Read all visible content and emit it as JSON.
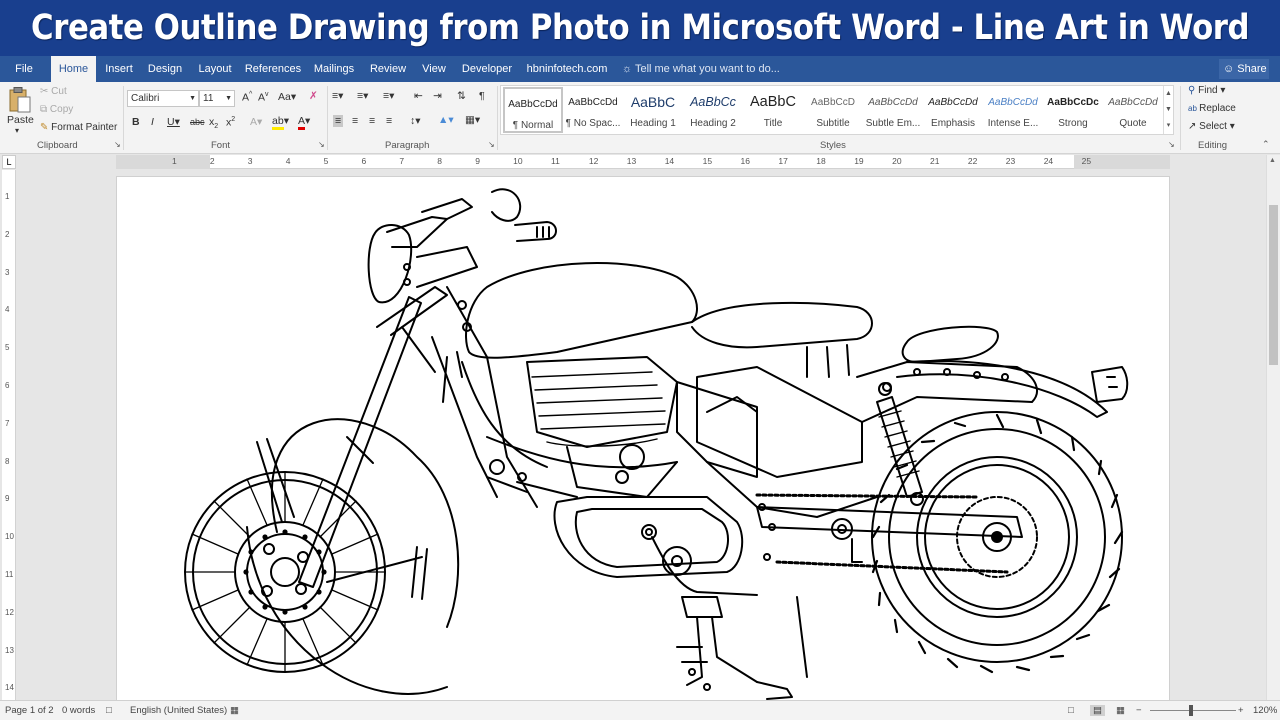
{
  "banner": {
    "title": "Create Outline Drawing from Photo in Microsoft Word - Line Art in Word"
  },
  "tabs": [
    {
      "label": "File"
    },
    {
      "label": "Home"
    },
    {
      "label": "Insert"
    },
    {
      "label": "Design"
    },
    {
      "label": "Layout"
    },
    {
      "label": "References"
    },
    {
      "label": "Mailings"
    },
    {
      "label": "Review"
    },
    {
      "label": "View"
    },
    {
      "label": "Developer"
    },
    {
      "label": "hbninfotech.com"
    }
  ],
  "active_tab": "Home",
  "tell_me": "Tell me what you want to do...",
  "share": "Share",
  "clipboard": {
    "paste": "Paste",
    "cut": "Cut",
    "copy": "Copy",
    "format_painter": "Format Painter",
    "group": "Clipboard"
  },
  "font": {
    "name": "Calibri",
    "size": "11",
    "group": "Font"
  },
  "paragraph": {
    "group": "Paragraph"
  },
  "styles": {
    "group": "Styles",
    "items": [
      {
        "preview": "AaBbCcDd",
        "name": "¶ Normal"
      },
      {
        "preview": "AaBbCcDd",
        "name": "¶ No Spac..."
      },
      {
        "preview": "AaBbC",
        "name": "Heading 1"
      },
      {
        "preview": "AaBbCc",
        "name": "Heading 2"
      },
      {
        "preview": "AaBbC",
        "name": "Title"
      },
      {
        "preview": "AaBbCcD",
        "name": "Subtitle"
      },
      {
        "preview": "AaBbCcDd",
        "name": "Subtle Em..."
      },
      {
        "preview": "AaBbCcDd",
        "name": "Emphasis"
      },
      {
        "preview": "AaBbCcDd",
        "name": "Intense E..."
      },
      {
        "preview": "AaBbCcDc",
        "name": "Strong"
      },
      {
        "preview": "AaBbCcDd",
        "name": "Quote"
      }
    ]
  },
  "editing": {
    "find": "Find",
    "replace": "Replace",
    "select": "Select",
    "group": "Editing"
  },
  "ruler_numbers": [
    "1",
    "2",
    "3",
    "4",
    "5",
    "6",
    "7",
    "8",
    "9",
    "10",
    "11",
    "12",
    "13",
    "14",
    "15",
    "16",
    "17",
    "18",
    "19",
    "20",
    "21",
    "22",
    "23",
    "24",
    "25"
  ],
  "vruler_numbers": [
    "1",
    "2",
    "3",
    "4",
    "5",
    "6",
    "7",
    "8",
    "9",
    "10",
    "11",
    "12",
    "13",
    "14"
  ],
  "status": {
    "page": "Page 1 of 2",
    "words": "0 words",
    "language": "English (United States)",
    "zoom": "120%"
  },
  "colors": {
    "banner": "#193f8e",
    "ribbon_tab_bar": "#2b579a",
    "ribbon": "#f3f3f3",
    "drawing_stroke": "#000000"
  }
}
